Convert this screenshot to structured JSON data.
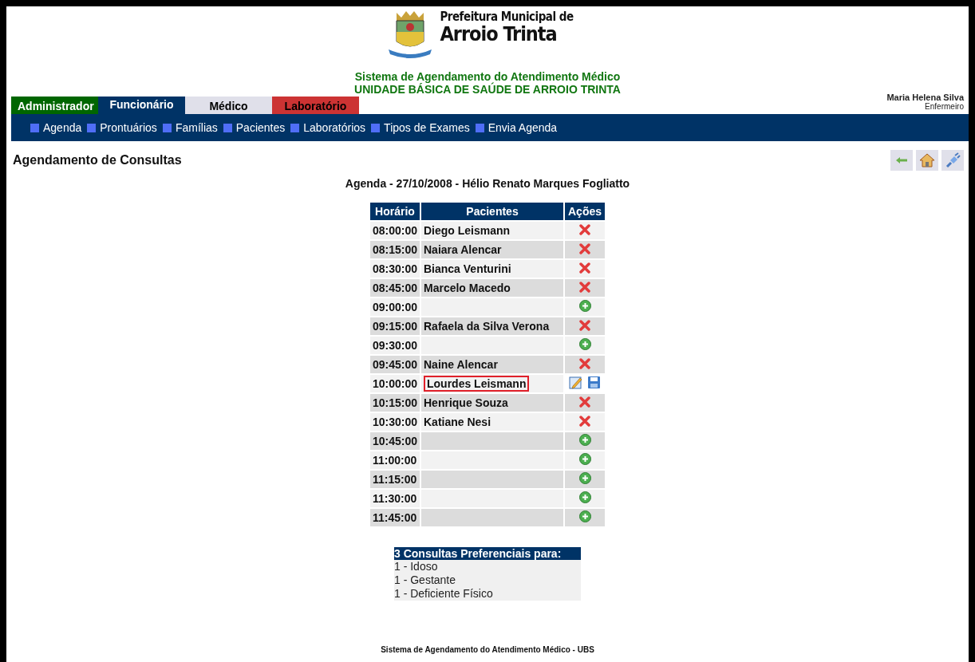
{
  "header": {
    "org_line_1": "Prefeitura Municipal de",
    "org_line_2": "Arroio Trinta",
    "system_title": "Sistema de Agendamento do Atendimento Médico",
    "unit_title": "UNIDADE BÁSICA DE SAÚDE DE ARROIO TRINTA"
  },
  "tabs": [
    {
      "label": "Administrador",
      "selected": false,
      "color": "#006600"
    },
    {
      "label": "Funcionário",
      "selected": true,
      "color": "#003366"
    },
    {
      "label": "Médico",
      "selected": false,
      "color": "#e0e0ea"
    },
    {
      "label": "Laboratório",
      "selected": false,
      "color": "#cc3333"
    }
  ],
  "user": {
    "name": "Maria Helena Silva",
    "role": "Enfermeiro"
  },
  "menu": [
    "Agenda",
    "Prontuários",
    "Famílias",
    "Pacientes",
    "Laboratórios",
    "Tipos de Exames",
    "Envia Agenda"
  ],
  "page_title": "Agendamento de Consultas",
  "agenda_title": "Agenda - 27/10/2008 - Hélio Renato Marques Fogliatto",
  "table": {
    "columns": [
      "Horário",
      "Pacientes",
      "Ações"
    ],
    "rows": [
      {
        "time": "08:00:00",
        "patient": "Diego Leismann",
        "kind": "booked"
      },
      {
        "time": "08:15:00",
        "patient": "Naiara Alencar",
        "kind": "booked"
      },
      {
        "time": "08:30:00",
        "patient": "Bianca Venturini",
        "kind": "booked"
      },
      {
        "time": "08:45:00",
        "patient": "Marcelo Macedo",
        "kind": "booked"
      },
      {
        "time": "09:00:00",
        "kind": "free"
      },
      {
        "time": "09:15:00",
        "patient": "Rafaela da Silva Verona",
        "kind": "booked"
      },
      {
        "time": "09:30:00",
        "kind": "free"
      },
      {
        "time": "09:45:00",
        "patient": "Naine Alencar",
        "kind": "booked"
      },
      {
        "time": "10:00:00",
        "patient": "Lourdes Leismann",
        "kind": "editing"
      },
      {
        "time": "10:15:00",
        "patient": "Henrique Souza",
        "kind": "booked"
      },
      {
        "time": "10:30:00",
        "patient": "Katiane Nesi",
        "kind": "booked"
      },
      {
        "time": "10:45:00",
        "kind": "free"
      },
      {
        "time": "11:00:00",
        "kind": "free"
      },
      {
        "time": "11:15:00",
        "kind": "free"
      },
      {
        "time": "11:30:00",
        "kind": "free"
      },
      {
        "time": "11:45:00",
        "kind": "free"
      }
    ]
  },
  "preferential": {
    "title": "3 Consultas Preferenciais para:",
    "items": [
      "1 - Idoso",
      "1 - Gestante",
      "1 - Deficiente Físico"
    ]
  },
  "footer": "Sistema de Agendamento do Atendimento Médico - UBS"
}
